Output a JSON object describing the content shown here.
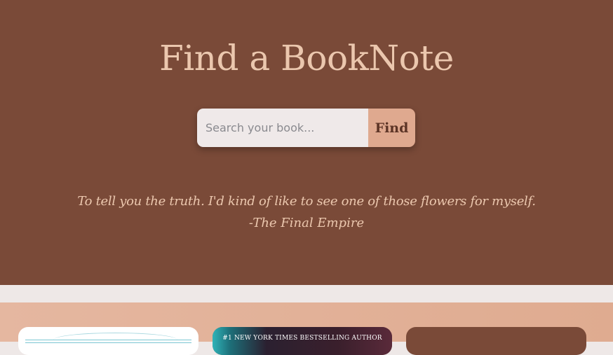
{
  "header": {
    "title": "Find a BookNote"
  },
  "search": {
    "placeholder": "Search your book...",
    "value": "",
    "button_label": "Find"
  },
  "quote": {
    "text": "To tell you the truth. I'd kind of like to see one of those flowers for myself.",
    "source": "-The Final Empire"
  },
  "books": {
    "cards": [
      {
        "cover_text": ""
      },
      {
        "cover_text": "#1 NEW YORK TIMES BESTSELLING AUTHOR"
      },
      {
        "cover_text": ""
      }
    ]
  },
  "colors": {
    "hero_bg": "#7a4a38",
    "accent_text": "#ebc7ae",
    "button_bg": "#dfa98f",
    "band_bg": "#e2b19a",
    "page_bg": "#eee8e7"
  }
}
